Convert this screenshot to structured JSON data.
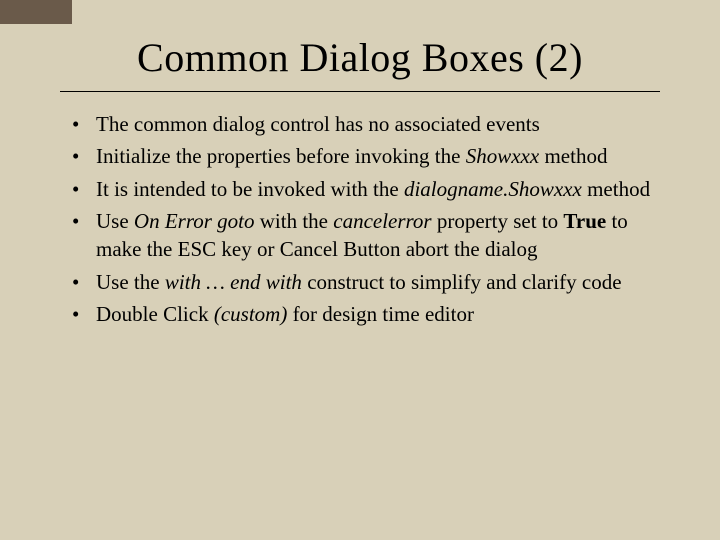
{
  "title": "Common Dialog Boxes (2)",
  "bullets": {
    "b1": "The common dialog control has no associated events",
    "b2a": "Initialize the properties before invoking the ",
    "b2b": "Showxxx",
    "b2c": " method",
    "b3a": "It is intended to be invoked with the ",
    "b3b": "dialogname.Showxxx",
    "b3c": " method",
    "b4a": "Use ",
    "b4b": "On Error goto",
    "b4c": " with the ",
    "b4d": "cancelerror",
    "b4e": " property set to ",
    "b4f": "True",
    "b4g": " to make the ESC key or Cancel Button abort the dialog",
    "b5a": "Use the ",
    "b5b": "with … end with",
    "b5c": " construct to simplify and clarify code",
    "b6a": "Double Click ",
    "b6b": "(custom)",
    "b6c": " for design time editor"
  }
}
